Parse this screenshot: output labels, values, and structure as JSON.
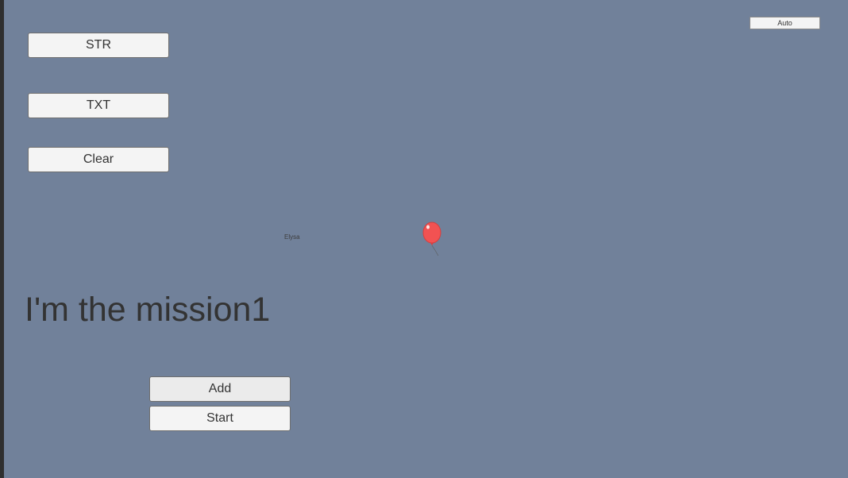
{
  "buttons": {
    "str": "STR",
    "txt": "TXT",
    "clear": "Clear",
    "add": "Add",
    "start": "Start",
    "auto": "Auto"
  },
  "character": {
    "name": "Elysa",
    "icon": "balloon-icon",
    "color": "#f25252"
  },
  "mission": {
    "text": "I'm the mission1"
  },
  "colors": {
    "background": "#71819a",
    "button": "#f4f4f4",
    "text": "#333333"
  }
}
